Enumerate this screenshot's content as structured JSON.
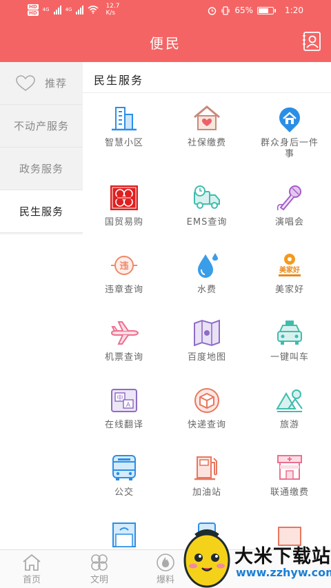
{
  "status_bar": {
    "network_speed": "12.7",
    "network_unit": "K/s",
    "battery": "65%",
    "time": "1:20",
    "hd_label": "HD",
    "signal_label": "4G"
  },
  "header": {
    "title": "便民"
  },
  "sidebar": {
    "items": [
      {
        "label": "推荐",
        "active": false
      },
      {
        "label": "不动产服务",
        "active": false
      },
      {
        "label": "政务服务",
        "active": false
      },
      {
        "label": "民生服务",
        "active": true
      }
    ]
  },
  "section": {
    "title": "民生服务",
    "services": [
      {
        "label": "智慧小区",
        "icon": "building-icon"
      },
      {
        "label": "社保缴费",
        "icon": "house-heart-icon"
      },
      {
        "label": "群众身后一件事",
        "icon": "house-location-icon"
      },
      {
        "label": "国贸易购",
        "icon": "guomao-logo-icon"
      },
      {
        "label": "EMS查询",
        "icon": "delivery-truck-icon"
      },
      {
        "label": "演唱会",
        "icon": "microphone-icon"
      },
      {
        "label": "违章查询",
        "icon": "violation-icon"
      },
      {
        "label": "水费",
        "icon": "water-drop-icon"
      },
      {
        "label": "美家好",
        "icon": "meijiahao-logo-icon"
      },
      {
        "label": "机票查询",
        "icon": "airplane-icon"
      },
      {
        "label": "百度地图",
        "icon": "map-icon"
      },
      {
        "label": "一键叫车",
        "icon": "taxi-icon"
      },
      {
        "label": "在线翻译",
        "icon": "translate-icon"
      },
      {
        "label": "快递查询",
        "icon": "package-icon"
      },
      {
        "label": "旅游",
        "icon": "mountain-icon"
      },
      {
        "label": "公交",
        "icon": "bus-icon"
      },
      {
        "label": "加油站",
        "icon": "gas-station-icon"
      },
      {
        "label": "联通缴费",
        "icon": "unicom-shop-icon"
      }
    ]
  },
  "bottom_nav": {
    "items": [
      {
        "label": "首页",
        "icon": "home-icon"
      },
      {
        "label": "文明",
        "icon": "clover-icon"
      },
      {
        "label": "爆料",
        "icon": "fire-icon"
      }
    ]
  },
  "watermark": {
    "title": "大米下载站",
    "url": "www.zzhyw.com"
  },
  "colors": {
    "primary": "#f56464",
    "accent_blue": "#2b8ee6",
    "accent_orange": "#f0876a"
  }
}
